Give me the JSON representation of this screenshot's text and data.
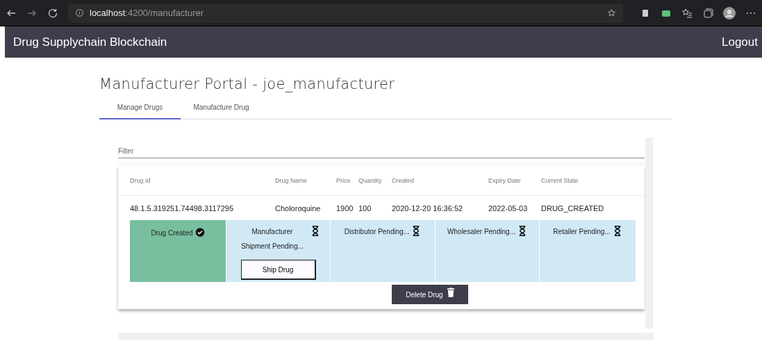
{
  "browser": {
    "url_host": "localhost",
    "url_path": ":4200/manufacturer"
  },
  "navbar": {
    "brand": "Drug Supplychain Blockchain",
    "logout": "Logout"
  },
  "page_title": "Manufacturer Portal - joe_manufacturer",
  "tabs": [
    {
      "label": "Manage Drugs",
      "selected": true
    },
    {
      "label": "Manufacture Drug",
      "selected": false
    }
  ],
  "filter": {
    "placeholder": "Filter"
  },
  "table": {
    "columns": [
      "Drug Id",
      "Drug Name",
      "Price",
      "Quantity",
      "Created",
      "Expiry Date",
      "Current State"
    ],
    "rows": [
      {
        "cells": [
          "48.1.5.319251.74498.3117295",
          "Choloroquine",
          "1900",
          "100",
          "2020-12-20 16:36:52",
          "2022-05-03",
          "DRUG_CREATED"
        ],
        "stages": [
          {
            "label": "Drug Created",
            "kind": "done"
          },
          {
            "label": "Manufacturer Shipment Pending...",
            "kind": "pending",
            "button": "Ship Drug"
          },
          {
            "label": "Distributor Pending...",
            "kind": "pending"
          },
          {
            "label": "Wholesaler Pending...",
            "kind": "pending"
          },
          {
            "label": "Retailer Pending...",
            "kind": "pending"
          }
        ],
        "delete_button": "Delete Drug"
      }
    ]
  }
}
